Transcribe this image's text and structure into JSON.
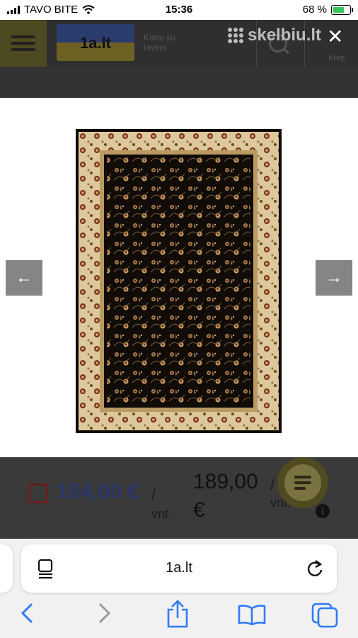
{
  "status_bar": {
    "carrier": "TAVO BITE",
    "time": "15:36",
    "battery": "68 %",
    "battery_level": 0.68
  },
  "site_header": {
    "logo_text": "1a.lt",
    "tagline_line1": "Kartu su",
    "tagline_line2": "tavimi",
    "partner_logo": "skelbiu.lt",
    "cart_label": "Krep"
  },
  "gallery": {
    "prev_label": "←",
    "next_label": "→",
    "close_label": "✕"
  },
  "prices": {
    "sale_price": "164,00 €",
    "sale_unit_slash": "/",
    "sale_unit": "vnt.",
    "regular_price_line1": "189,00",
    "regular_price_line2": "€",
    "regular_unit_slash": "/",
    "regular_unit": "vnt."
  },
  "browser": {
    "url": "1a.lt"
  },
  "colors": {
    "sale_price": "#2c3669",
    "rug_ground": "#120c08",
    "rug_border": "#dcc89a"
  },
  "icons": [
    "menu-icon",
    "search-icon",
    "close-icon",
    "chat-icon",
    "info-icon",
    "reader-icon",
    "reload-icon",
    "back-icon",
    "forward-icon",
    "share-icon",
    "bookmarks-icon",
    "tabs-icon"
  ]
}
